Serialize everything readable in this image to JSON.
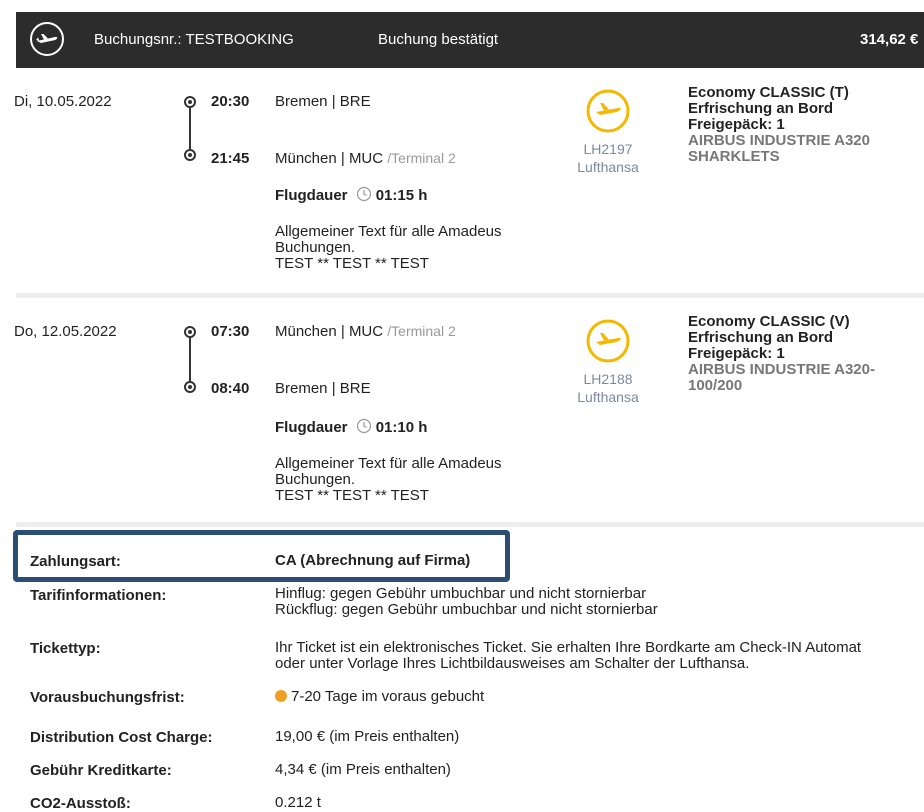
{
  "header": {
    "booking_label": "Buchungsnr.: TESTBOOKING",
    "status": "Buchung bestätigt",
    "price": "314,62 €"
  },
  "segments": [
    {
      "date": "Di,  10.05.2022",
      "dep_time": "20:30",
      "dep_place": "Bremen | BRE",
      "dep_terminal": "",
      "arr_time": "21:45",
      "arr_place": "München | MUC",
      "arr_terminal": "/Terminal 2",
      "duration_label": "Flugdauer",
      "duration": "01:15  h",
      "note_line1": "Allgemeiner Text für alle Amadeus",
      "note_line2": "Buchungen.",
      "note_line3": "TEST ** TEST ** TEST",
      "flight_no": "LH2197",
      "airline": "Lufthansa",
      "cabin": "Economy CLASSIC (T)",
      "meal": "Erfrischung an Bord",
      "baggage": "Freigepäck: 1",
      "aircraft_line1": "AIRBUS INDUSTRIE A320",
      "aircraft_line2": "SHARKLETS"
    },
    {
      "date": "Do,  12.05.2022",
      "dep_time": "07:30",
      "dep_place": "München | MUC",
      "dep_terminal": "/Terminal 2",
      "arr_time": "08:40",
      "arr_place": "Bremen | BRE",
      "arr_terminal": "",
      "duration_label": "Flugdauer",
      "duration": "01:10  h",
      "note_line1": "Allgemeiner Text für alle Amadeus",
      "note_line2": "Buchungen.",
      "note_line3": "TEST ** TEST ** TEST",
      "flight_no": "LH2188",
      "airline": "Lufthansa",
      "cabin": "Economy CLASSIC (V)",
      "meal": "Erfrischung an Bord",
      "baggage": "Freigepäck: 1",
      "aircraft_line1": "AIRBUS INDUSTRIE A320-",
      "aircraft_line2": "100/200"
    }
  ],
  "details": {
    "zahlungsart_label": "Zahlungsart:",
    "zahlungsart_value": "CA (Abrechnung auf Firma)",
    "tarif_label": "Tarifinformationen:",
    "tarif_line1": "Hinflug: gegen Gebühr umbuchbar und nicht stornierbar",
    "tarif_line2": "Rückflug: gegen Gebühr umbuchbar und nicht stornierbar",
    "ticket_label": "Tickettyp:",
    "ticket_line1": "Ihr Ticket ist ein elektronisches Ticket. Sie erhalten Ihre Bordkarte am Check-IN Automat",
    "ticket_line2": "oder unter Vorlage Ihres Lichtbildausweises am Schalter der Lufthansa.",
    "voraus_label": "Vorausbuchungsfrist:",
    "voraus_value": "7-20 Tage im voraus gebucht",
    "dcc_label": "Distribution Cost Charge:",
    "dcc_value": "19,00 €  (im Preis enthalten)",
    "kk_label": "Gebühr Kreditkarte:",
    "kk_value": "4,34 €  (im Preis enthalten)",
    "co2_label": "CO2-Ausstoß:",
    "co2_value": "0.212 t"
  },
  "colors": {
    "header_bg": "#2c2c2c",
    "highlight_border": "#2c4e73",
    "lufthansa_yellow": "#f5b800",
    "advance_dot": "#f0a020"
  }
}
